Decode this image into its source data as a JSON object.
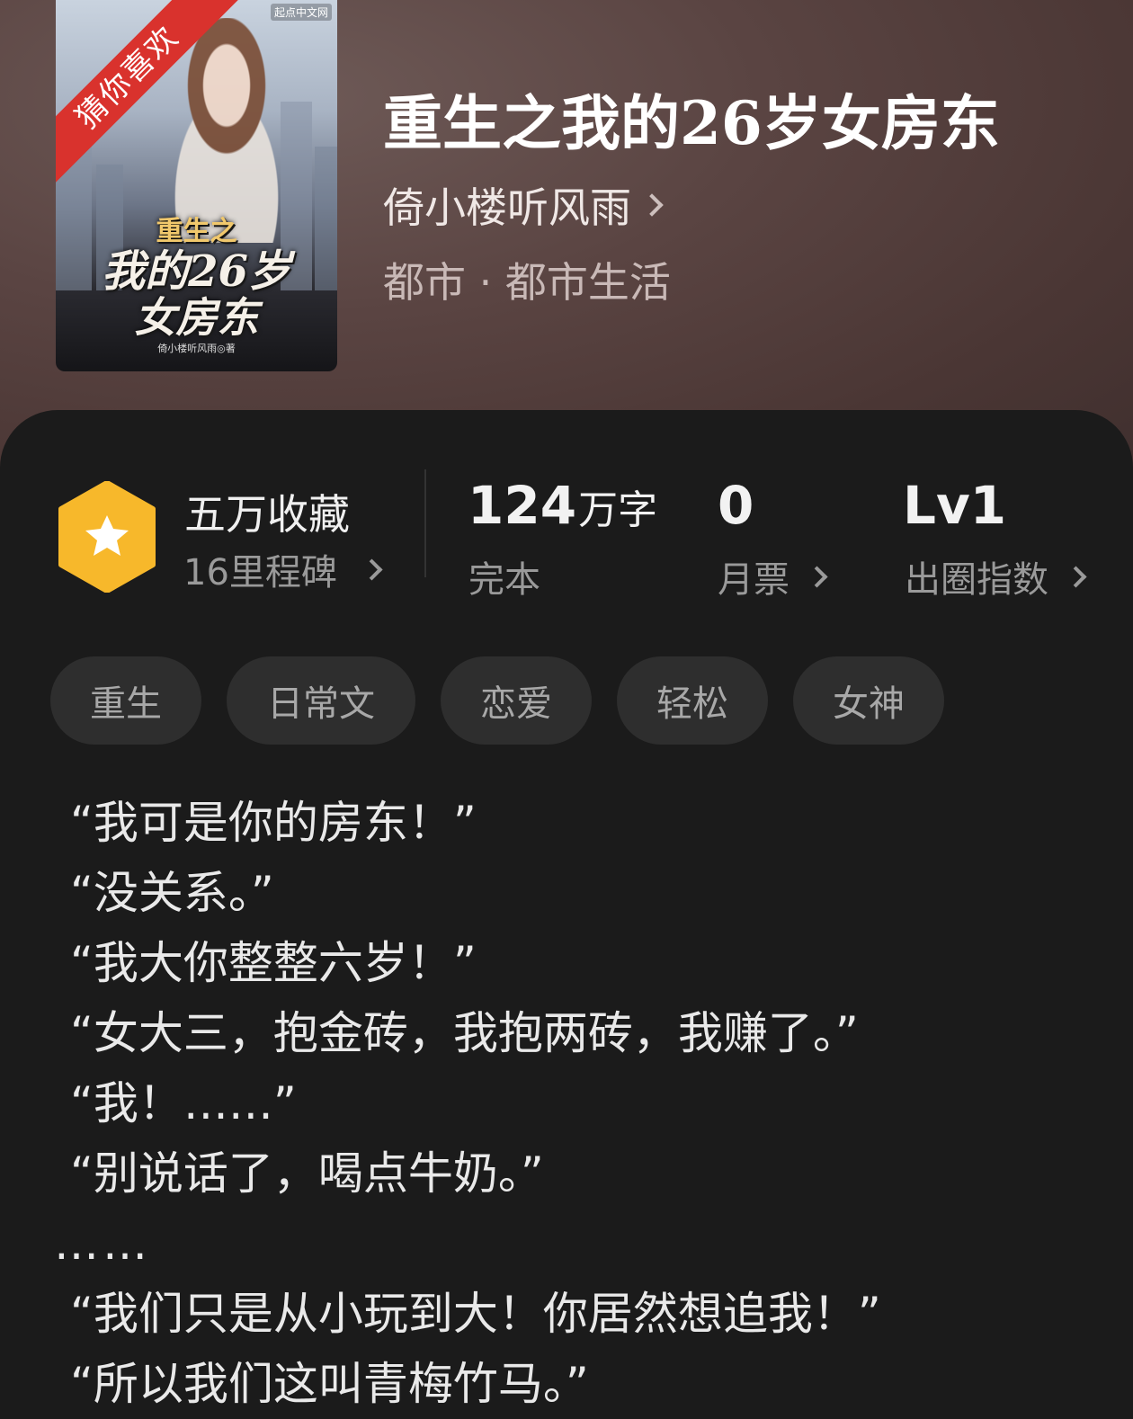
{
  "book": {
    "title": "重生之我的26岁女房东",
    "author": "倚小楼听风雨",
    "genre": "都市 · 都市生活"
  },
  "cover": {
    "ribbon": "猜你喜欢",
    "publisher": "起点中文网",
    "title_line1": "重生之",
    "title_line2": "我的26岁",
    "title_line3": "女房东",
    "author_credit": "倚小楼听风雨◎著",
    "ribbon_color": "#d9322d"
  },
  "stats": {
    "favorites": {
      "title": "五万收藏",
      "sub": "16里程碑",
      "icon": "star-hexagon-icon",
      "color": "#f7b82b"
    },
    "words": {
      "value": "124",
      "unit": "万字",
      "label": "完本"
    },
    "monthly_ticket": {
      "value": "0",
      "label": "月票"
    },
    "influence": {
      "value": "Lv1",
      "label": "出圈指数"
    }
  },
  "tags": [
    "重生",
    "日常文",
    "恋爱",
    "轻松",
    "女神"
  ],
  "description": [
    "“我可是你的房东！”",
    "“没关系。”",
    "“我大你整整六岁！”",
    "“女大三，抱金砖，我抱两砖，我赚了。”",
    "“我！……”",
    "“别说话了，喝点牛奶。”",
    "……",
    "“我们只是从小玩到大！你居然想追我！”",
    "“所以我们这叫青梅竹马。”"
  ]
}
